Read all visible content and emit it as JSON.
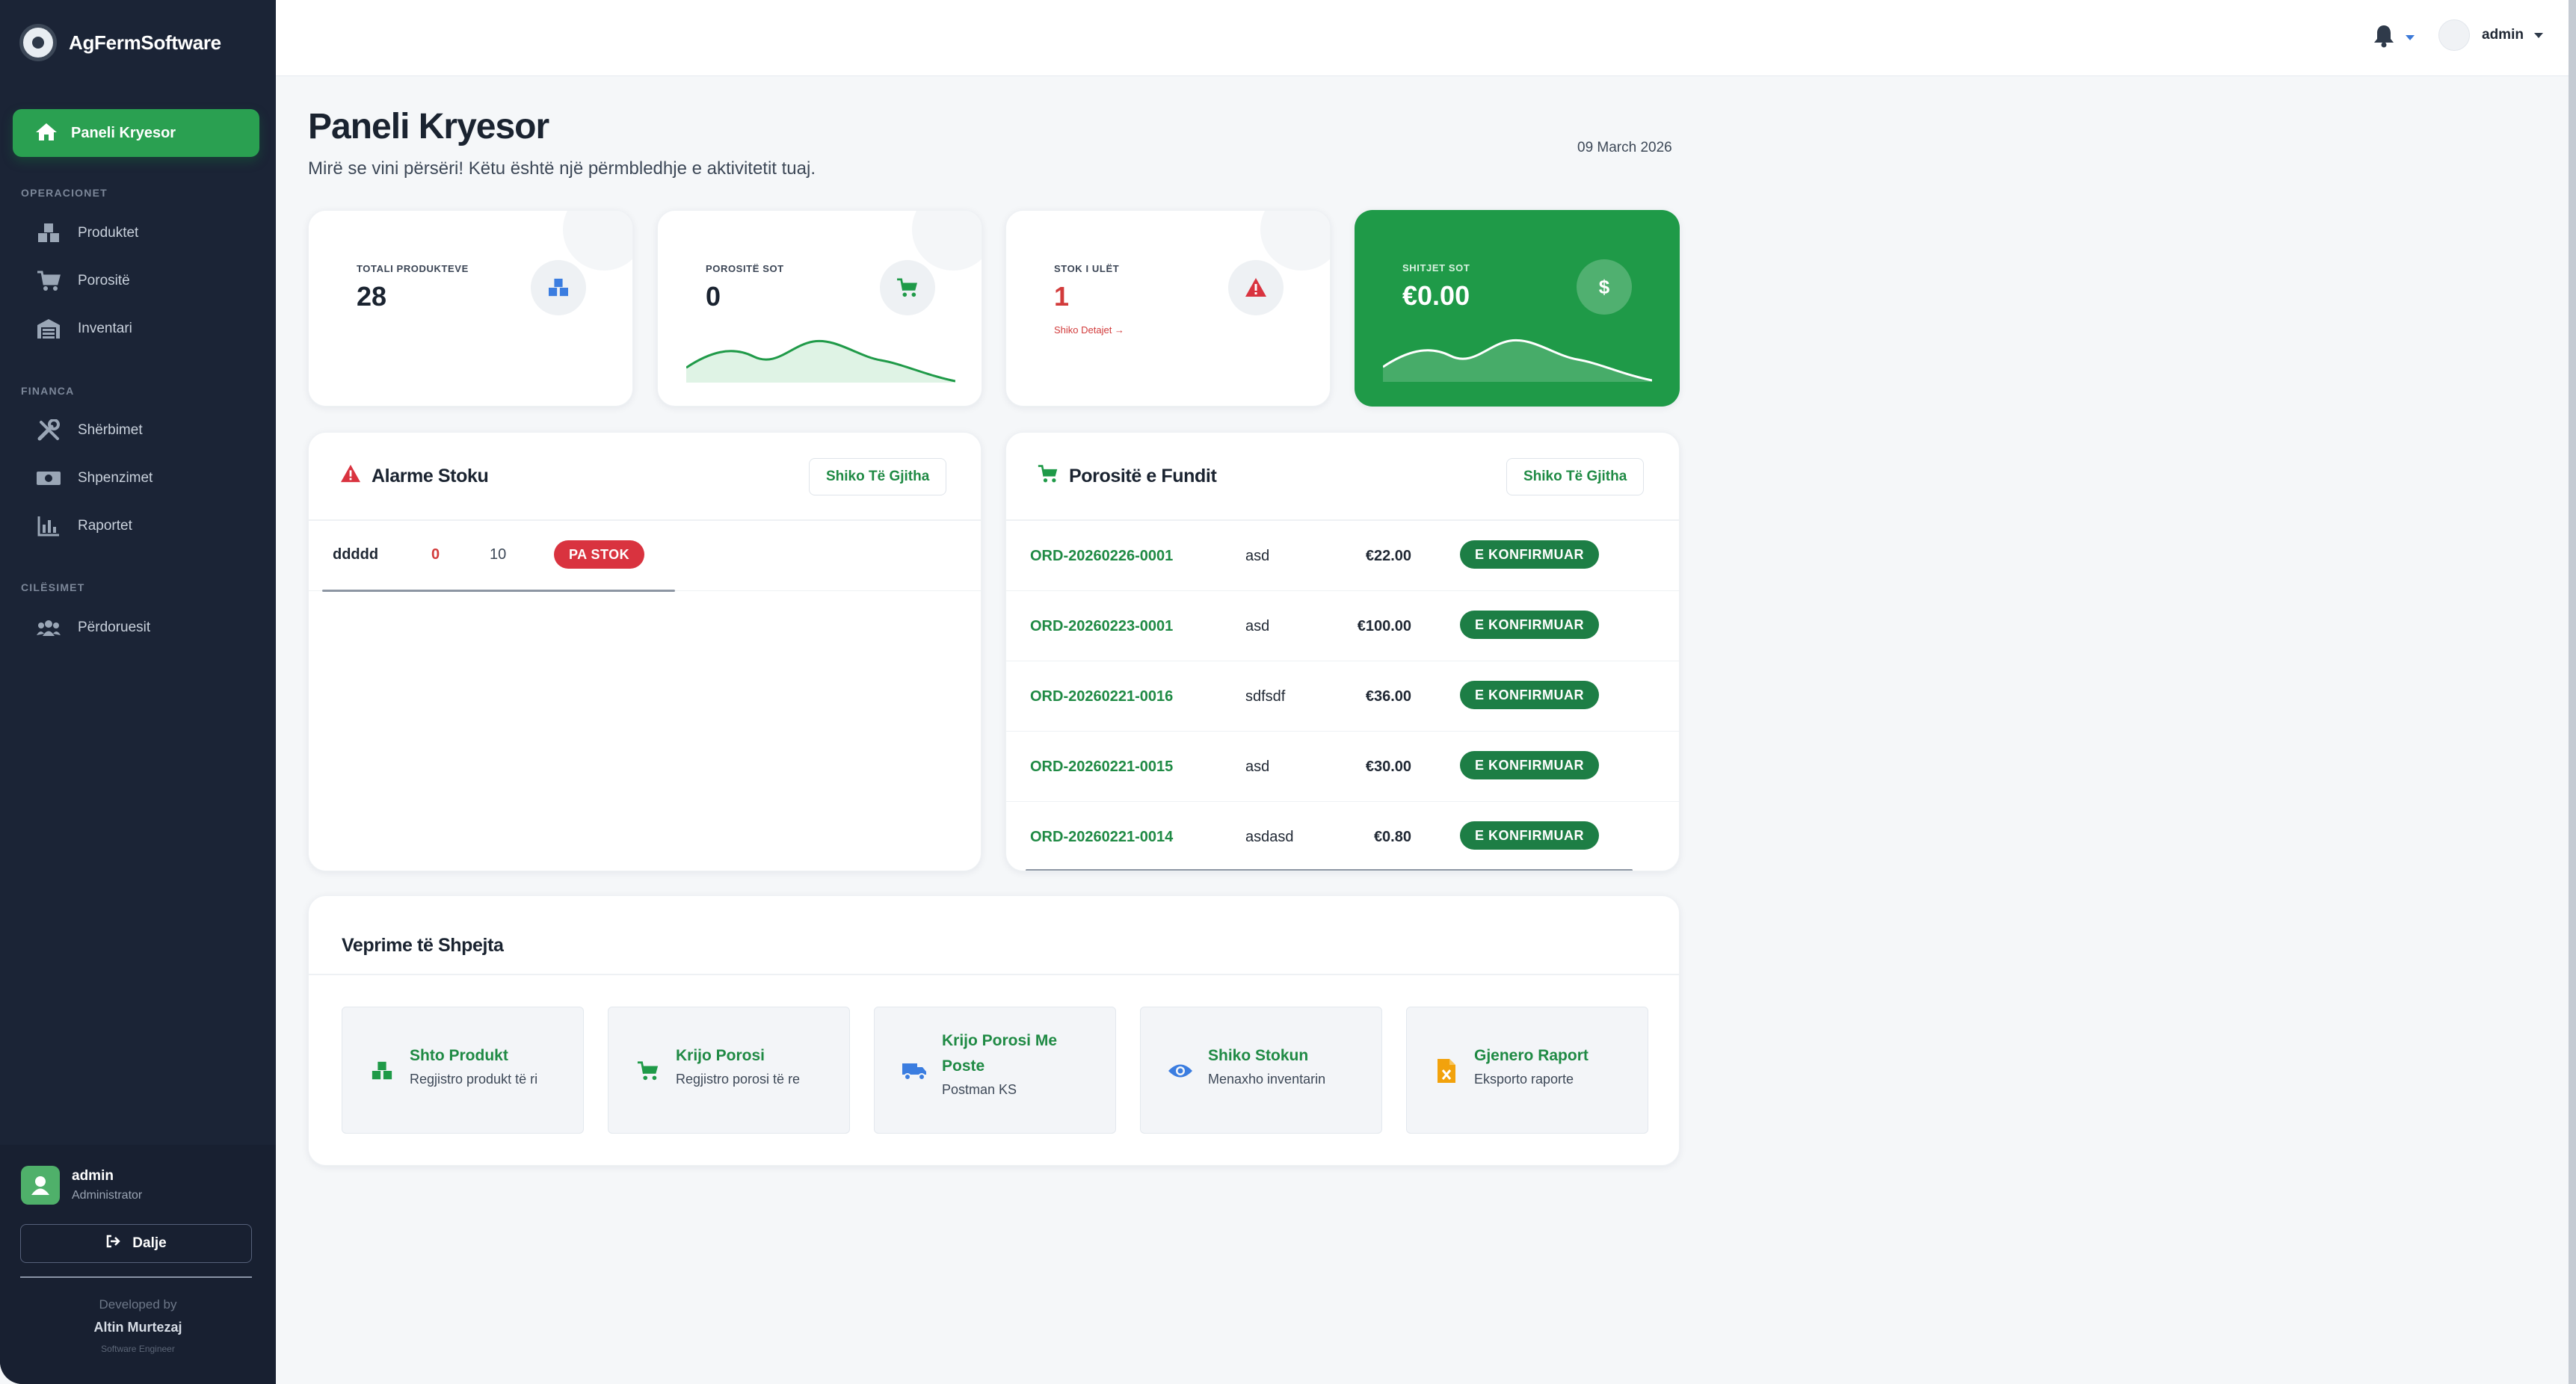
{
  "brand": {
    "name": "AgFermSoftware"
  },
  "sidebar": {
    "active": {
      "label": "Paneli Kryesor"
    },
    "sections": [
      {
        "label": "OPERACIONET",
        "items": [
          {
            "label": "Produktet",
            "icon": "boxes-icon"
          },
          {
            "label": "Porositë",
            "icon": "cart-icon"
          },
          {
            "label": "Inventari",
            "icon": "warehouse-icon"
          }
        ]
      },
      {
        "label": "FINANCA",
        "items": [
          {
            "label": "Shërbimet",
            "icon": "tools-icon"
          },
          {
            "label": "Shpenzimet",
            "icon": "money-icon"
          },
          {
            "label": "Raportet",
            "icon": "chart-icon"
          }
        ]
      },
      {
        "label": "CILËSIMET",
        "items": [
          {
            "label": "Përdoruesit",
            "icon": "users-icon"
          }
        ]
      }
    ],
    "user": {
      "name": "admin",
      "role": "Administrator"
    },
    "logout_label": "Dalje",
    "developed_by": "Developed by",
    "developer_name": "Altin Murtezaj",
    "developer_role": "Software Engineer"
  },
  "topbar": {
    "user_name": "admin"
  },
  "header": {
    "title": "Paneli Kryesor",
    "subtitle": "Mirë se vini përsëri! Këtu është një përmbledhje e aktivitetit tuaj.",
    "date": "09 March 2026"
  },
  "stats": [
    {
      "label": "TOTALI PRODUKTEVE",
      "value": "28",
      "icon": "boxes-icon"
    },
    {
      "label": "POROSITË SOT",
      "value": "0",
      "icon": "cart-icon"
    },
    {
      "label": "STOK I ULËT",
      "value": "1",
      "icon": "warning-icon",
      "link": "Shiko Detajet →"
    },
    {
      "label": "SHITJET SOT",
      "value": "€0.00",
      "icon": "dollar-icon"
    }
  ],
  "stock_alarms": {
    "title": "Alarme Stoku",
    "view_all": "Shiko Të Gjitha",
    "rows": [
      {
        "name": "ddddd",
        "current": "0",
        "min": "10",
        "status": "PA STOK"
      }
    ]
  },
  "recent_orders": {
    "title": "Porositë e Fundit",
    "view_all": "Shiko Të Gjitha",
    "rows": [
      {
        "id": "ORD-20260226-0001",
        "customer": "asd",
        "amount": "€22.00",
        "status": "E KONFIRMUAR"
      },
      {
        "id": "ORD-20260223-0001",
        "customer": "asd",
        "amount": "€100.00",
        "status": "E KONFIRMUAR"
      },
      {
        "id": "ORD-20260221-0016",
        "customer": "sdfsdf",
        "amount": "€36.00",
        "status": "E KONFIRMUAR"
      },
      {
        "id": "ORD-20260221-0015",
        "customer": "asd",
        "amount": "€30.00",
        "status": "E KONFIRMUAR"
      },
      {
        "id": "ORD-20260221-0014",
        "customer": "asdasd",
        "amount": "€0.80",
        "status": "E KONFIRMUAR"
      }
    ]
  },
  "quick_actions": {
    "title": "Veprime të Shpejta",
    "items": [
      {
        "title": "Shto Produkt",
        "subtitle": "Regjistro produkt të ri",
        "icon": "boxes-icon"
      },
      {
        "title": "Krijo Porosi",
        "subtitle": "Regjistro porosi të re",
        "icon": "cart-icon"
      },
      {
        "title": "Krijo Porosi Me Poste",
        "subtitle": "Postman KS",
        "icon": "truck-icon"
      },
      {
        "title": "Shiko Stokun",
        "subtitle": "Menaxho inventarin",
        "icon": "eye-icon"
      },
      {
        "title": "Gjenero Raport",
        "subtitle": "Eksporto raporte",
        "icon": "excel-file-icon"
      }
    ]
  },
  "colors": {
    "sidebar_bg": "#1b2436",
    "accent_green": "#2aa051",
    "link_green": "#1f8a44",
    "danger": "#d9333f",
    "confirmed": "#1d7e45"
  }
}
